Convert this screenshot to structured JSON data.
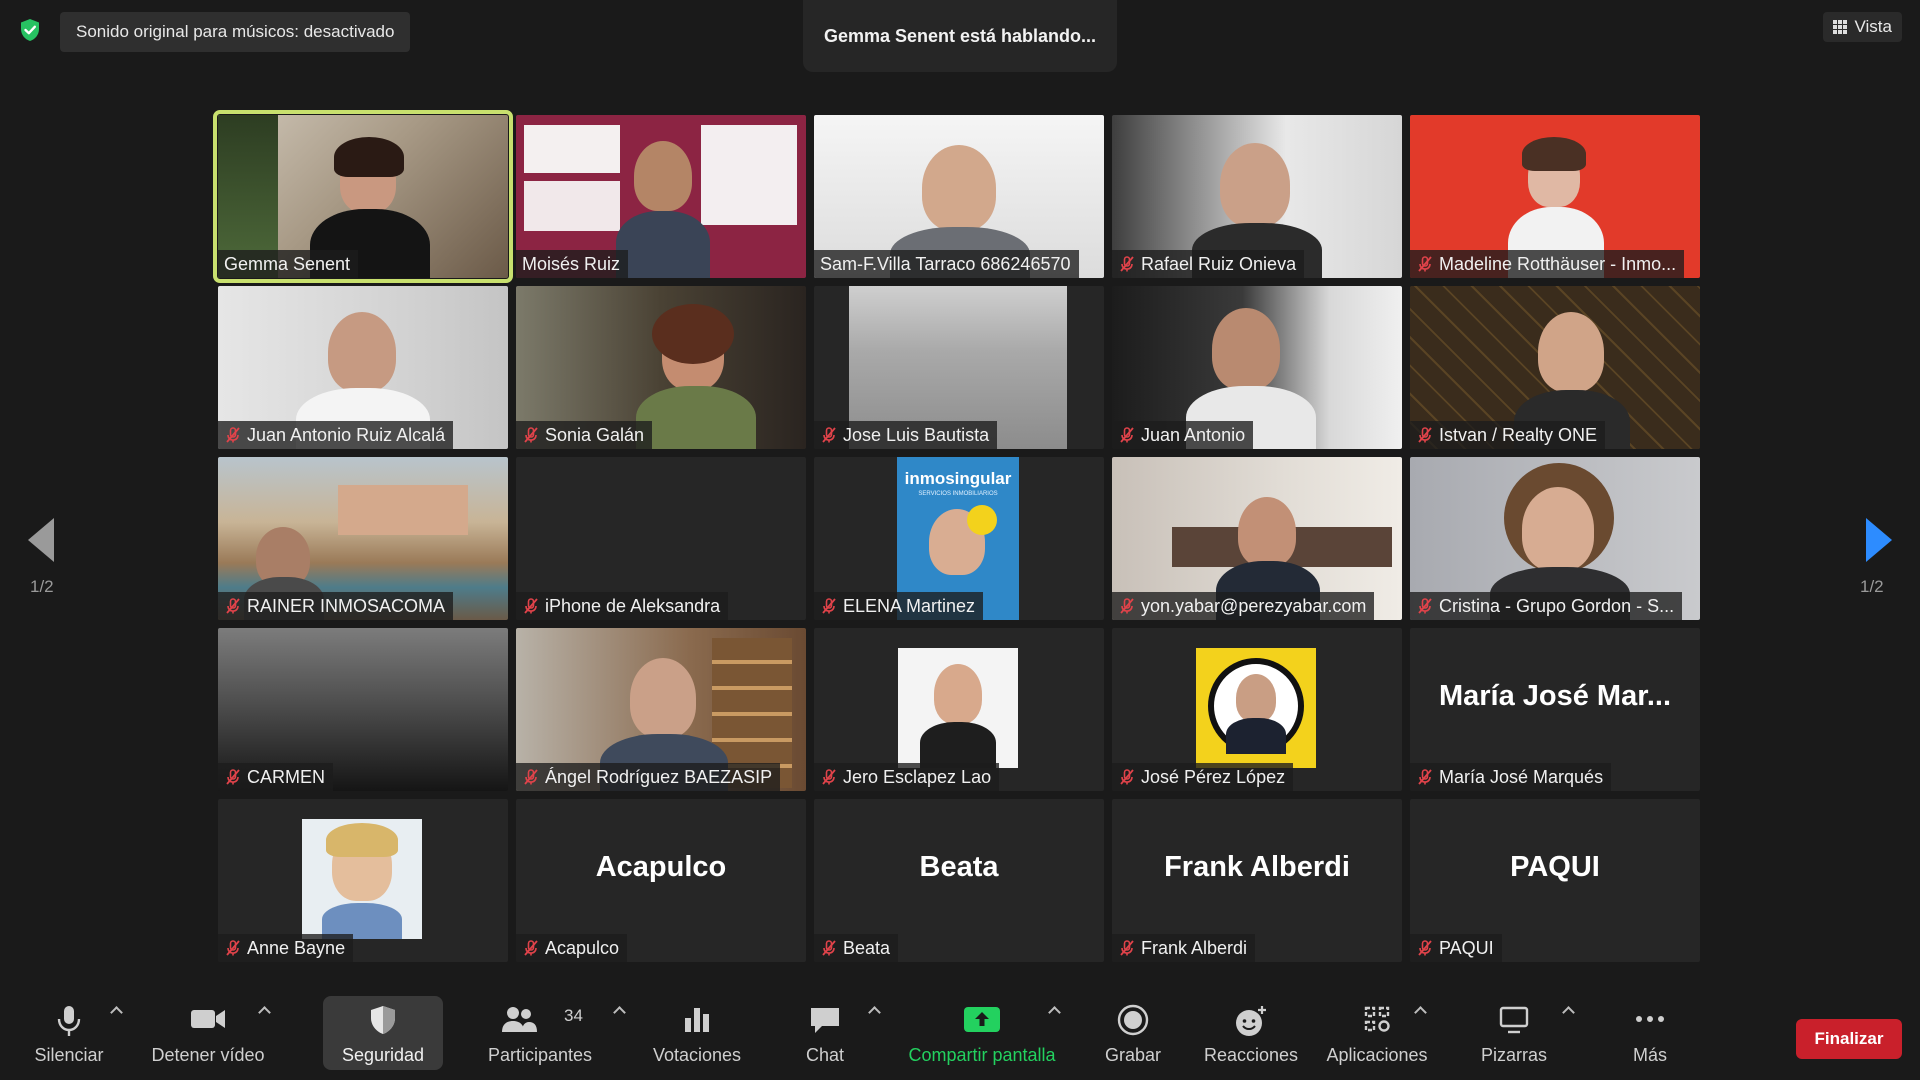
{
  "top": {
    "notice": "Sonido original para músicos: desactivado",
    "speaking": "Gemma Senent está hablando...",
    "view_label": "Vista"
  },
  "pagination": {
    "left": "1/2",
    "right": "1/2"
  },
  "tiles": [
    {
      "name": "Gemma Senent",
      "muted": false,
      "active": true,
      "display": "video"
    },
    {
      "name": "Moisés Ruiz",
      "muted": false,
      "display": "video"
    },
    {
      "name": "Sam-F.Villa Tarraco 686246570",
      "muted": false,
      "display": "video"
    },
    {
      "name": "Rafael Ruiz Onieva",
      "muted": true,
      "display": "video"
    },
    {
      "name": "Madeline Rotthäuser - Inmo...",
      "muted": true,
      "display": "video"
    },
    {
      "name": "Juan Antonio Ruiz Alcalá",
      "muted": true,
      "display": "video"
    },
    {
      "name": "Sonia Galán",
      "muted": true,
      "display": "video"
    },
    {
      "name": "Jose Luis Bautista",
      "muted": true,
      "display": "video"
    },
    {
      "name": "Juan Antonio",
      "muted": true,
      "display": "video"
    },
    {
      "name": "Istvan / Realty ONE",
      "muted": true,
      "display": "video"
    },
    {
      "name": "RAINER INMOSACOMA",
      "muted": true,
      "display": "video"
    },
    {
      "name": "iPhone de Aleksandra",
      "muted": true,
      "display": "blank"
    },
    {
      "name": "ELENA Martinez",
      "muted": true,
      "display": "photo",
      "photo_text": "inmosingular",
      "photo_subtext": "SERVICIOS INMOBILIARIOS"
    },
    {
      "name": "yon.yabar@perezyabar.com",
      "muted": true,
      "display": "video"
    },
    {
      "name": "Cristina - Grupo Gordon - S...",
      "muted": true,
      "display": "video"
    },
    {
      "name": "CARMEN",
      "muted": true,
      "display": "video"
    },
    {
      "name": "Ángel Rodríguez BAEZASIP",
      "muted": true,
      "display": "video"
    },
    {
      "name": "Jero Esclapez Lao",
      "muted": true,
      "display": "photo"
    },
    {
      "name": "José Pérez López",
      "muted": true,
      "display": "photo"
    },
    {
      "name": "María José Marqués",
      "muted": true,
      "display": "text",
      "big_text": "María José Mar..."
    },
    {
      "name": "Anne Bayne",
      "muted": true,
      "display": "photo"
    },
    {
      "name": "Acapulco",
      "muted": true,
      "display": "text",
      "big_text": "Acapulco"
    },
    {
      "name": "Beata",
      "muted": true,
      "display": "text",
      "big_text": "Beata"
    },
    {
      "name": "Frank Alberdi",
      "muted": true,
      "display": "text",
      "big_text": "Frank Alberdi"
    },
    {
      "name": "PAQUI",
      "muted": true,
      "display": "text",
      "big_text": "PAQUI"
    }
  ],
  "toolbar": {
    "mute": "Silenciar",
    "video": "Detener vídeo",
    "security": "Seguridad",
    "participants": "Participantes",
    "participants_count": "34",
    "polls": "Votaciones",
    "chat": "Chat",
    "share": "Compartir pantalla",
    "record": "Grabar",
    "reactions": "Reacciones",
    "apps": "Aplicaciones",
    "whiteboards": "Pizarras",
    "more": "Más",
    "end": "Finalizar"
  },
  "colors": {
    "active_speaker_border": "#c8e06e",
    "share_green": "#23d15f",
    "end_red": "#c9202b",
    "next_arrow_blue": "#2d8cff",
    "mute_red": "#e0434a"
  }
}
